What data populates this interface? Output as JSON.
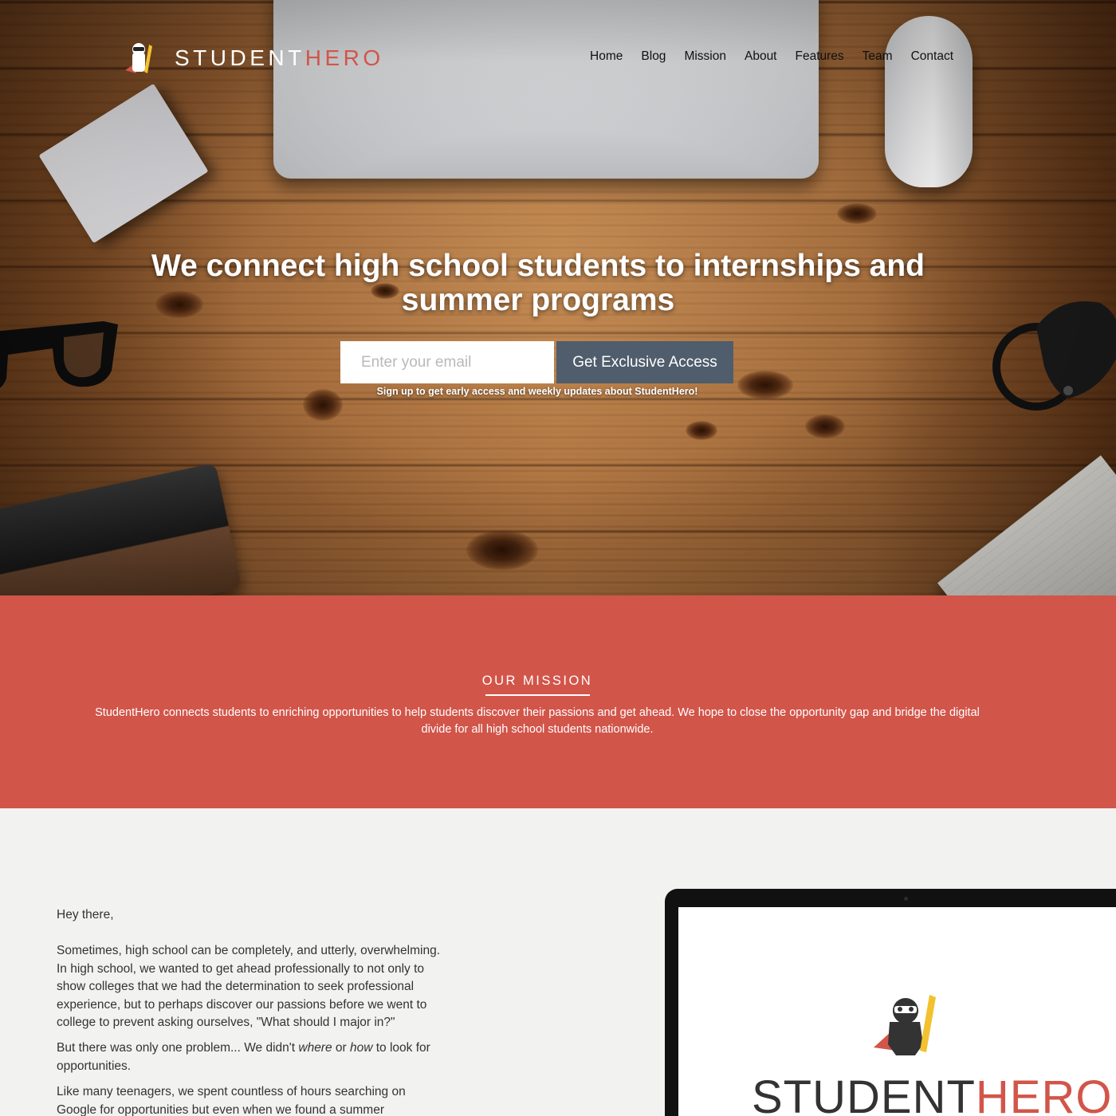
{
  "brand": {
    "name_part1": "STUDENT",
    "name_part2": "HERO",
    "accent_color": "#d2554a",
    "button_color": "#4f5d6c"
  },
  "nav": {
    "items": [
      "Home",
      "Blog",
      "Mission",
      "About",
      "Features",
      "Team",
      "Contact"
    ]
  },
  "hero": {
    "headline": "We connect high school students to internships and summer programs",
    "email_placeholder": "Enter your email",
    "cta_label": "Get Exclusive Access",
    "note": "Sign up to get early access and weekly updates about StudentHero!"
  },
  "mission": {
    "title": "OUR MISSION",
    "text": "StudentHero connects students to enriching opportunities to help students discover their passions and get ahead. We hope to close the opportunity gap and bridge the digital divide for all high school students nationwide."
  },
  "letter": {
    "greeting": "Hey there,",
    "p1": "Sometimes, high school can be completely, and utterly, overwhelming. In high school, we wanted to get ahead professionally to not only to show colleges that we had the determination to seek professional experience, but to perhaps discover our passions before we went to college to prevent asking ourselves, \"What should I major in?\"",
    "p2_a": "But there was only one problem... We didn't ",
    "p2_em1": "where",
    "p2_b": " or ",
    "p2_em2": "how",
    "p2_c": " to look for opportunities.",
    "p3": "Like many teenagers, we spent countless of hours searching on Google for opportunities but even when we found a summer"
  },
  "device_screen": {
    "name_part1": "STUDENT",
    "name_part2": "HERO"
  },
  "icons": {
    "logo": "hero-mascot-icon",
    "device_logo": "hero-mascot-icon"
  }
}
